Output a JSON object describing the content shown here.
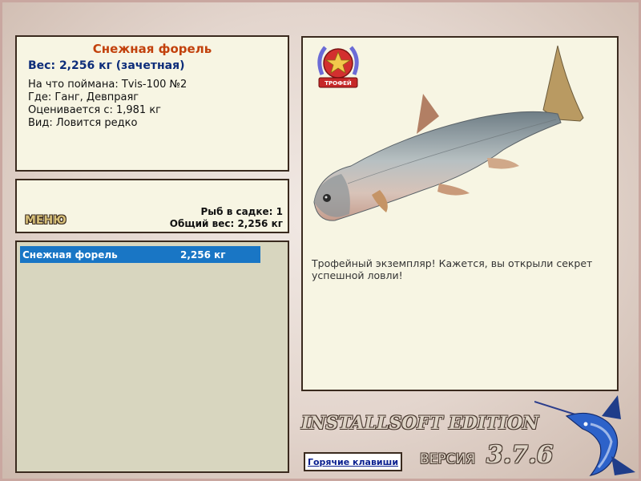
{
  "fish_info": {
    "name": "Снежная форель",
    "weight": "Вес: 2,256 кг (зачетная)",
    "bait": "На что поймана: Tvis-100 №2",
    "location": "Где: Ганг, Девпраяг",
    "valued_from": "Оценивается с: 1,981 кг",
    "rarity": "Вид: Ловится редко"
  },
  "stats": {
    "menu_label": "МЕНЮ",
    "fish_count": "Рыб в садке: 1",
    "total_weight": "Общий вес: 2,256 кг"
  },
  "catch_list": [
    {
      "name": "Снежная форель",
      "weight": "2,256 кг"
    }
  ],
  "display": {
    "trophy_badge": "ТРОФЕЙ",
    "description": "Трофейный экземпляр! Кажется, вы открыли секрет успешной ловли!"
  },
  "footer": {
    "edition": "INSTALLSOFT EDITION",
    "hotkeys_label": "Горячие клавиши",
    "version_label": "ВЕРСИЯ",
    "version_number": "3.7.6"
  },
  "colors": {
    "panel_bg": "#f7f5e3",
    "panel_border": "#3a2a1e",
    "title": "#c2410c",
    "weight": "#0d2d7a",
    "selection": "#1976c5"
  }
}
